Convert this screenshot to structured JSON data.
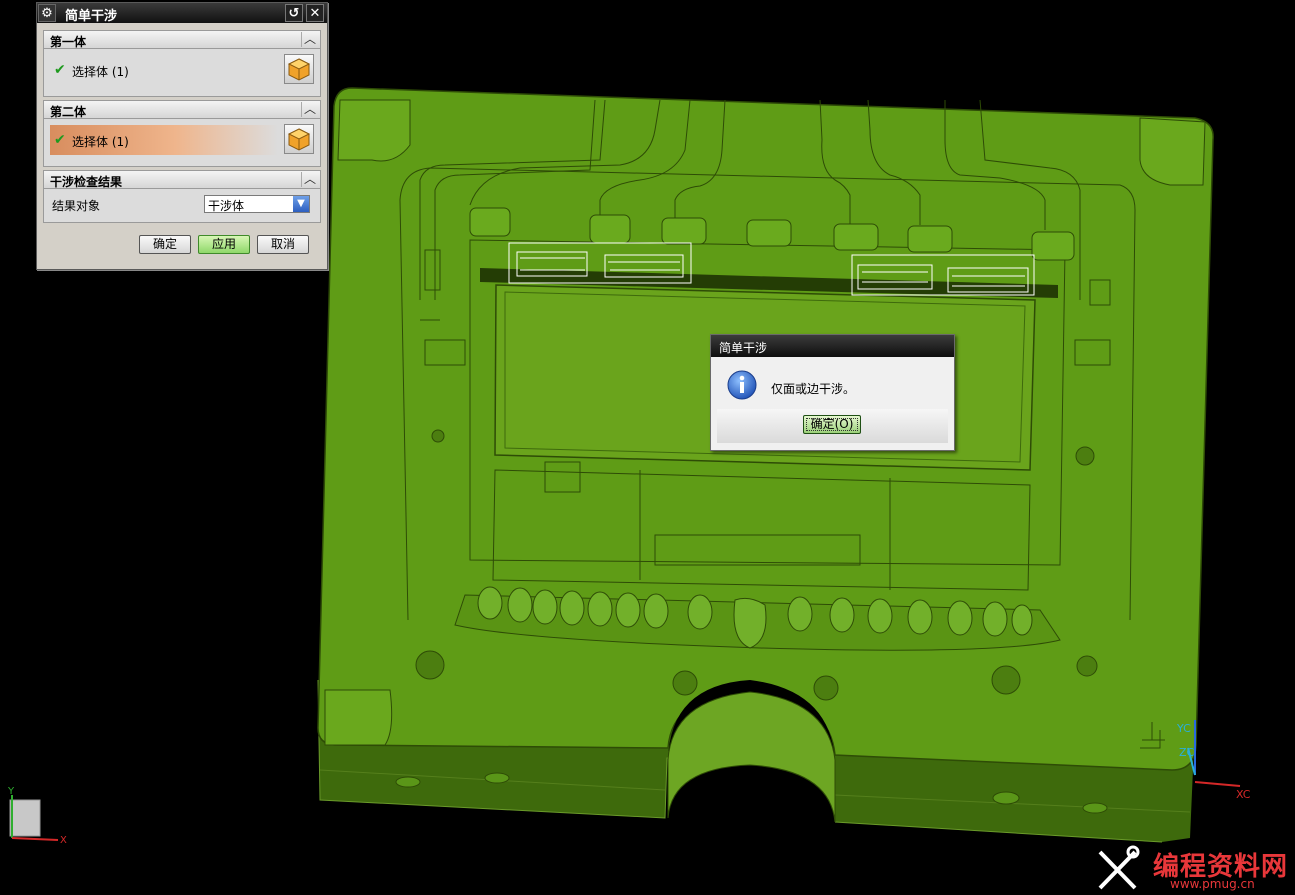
{
  "tool_dialog": {
    "title": "简单干涉",
    "sections": {
      "first_body": {
        "header": "第一体",
        "select_label": "选择体 (1)"
      },
      "second_body": {
        "header": "第二体",
        "select_label": "选择体 (1)"
      },
      "results": {
        "header": "干涉检查结果",
        "result_object_label": "结果对象",
        "result_object_value": "干涉体"
      }
    },
    "buttons": {
      "ok": "确定",
      "apply": "应用",
      "cancel": "取消"
    }
  },
  "message_box": {
    "title": "简单干涉",
    "text": "仅面或边干涉。",
    "ok_button": "确定(O)"
  },
  "axes": {
    "wcs": {
      "y": "YC",
      "z": "ZC",
      "x": "XC"
    },
    "absolute": {
      "y": "Y",
      "x": "X"
    }
  },
  "watermark": {
    "text": "编程资料网",
    "url": "www.pmug.cn"
  },
  "colors": {
    "model_green": "#5e9a16",
    "model_side": "#3d6a0c",
    "background": "#000000"
  },
  "icons": [
    "gear-icon",
    "reset-icon",
    "close-icon",
    "checkmark-icon",
    "cube-icon",
    "info-icon",
    "chevron-up-icon",
    "dropdown-arrow-icon",
    "tools-icon"
  ]
}
